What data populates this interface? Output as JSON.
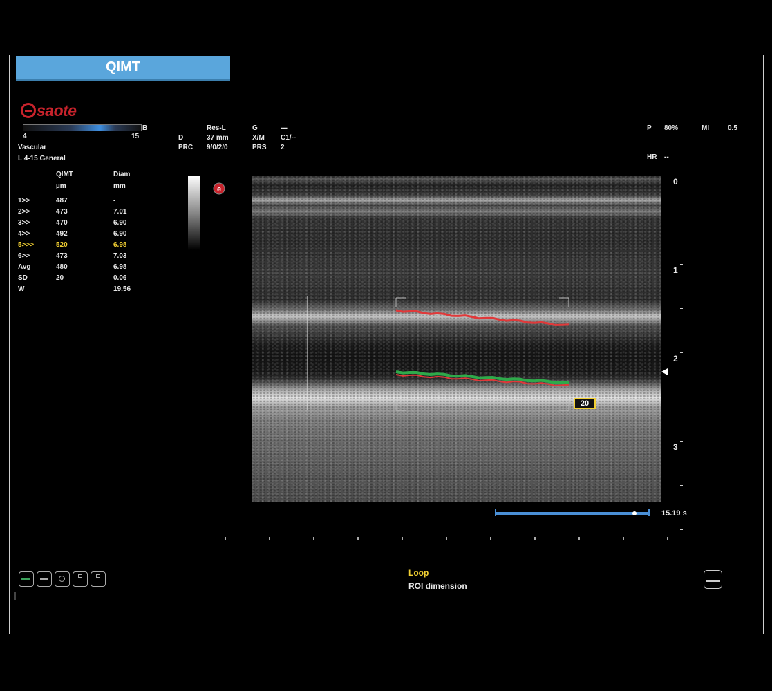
{
  "mode": {
    "title": "QIMT"
  },
  "brand": {
    "name": "saote"
  },
  "dynamic_range": {
    "left": "4",
    "right": "15",
    "unit": "B"
  },
  "preset": {
    "application": "Vascular",
    "probe": "L 4-15  General"
  },
  "params": [
    {
      "key": "Res-L",
      "value": ""
    },
    {
      "key": "D",
      "value": "37 mm"
    },
    {
      "key": "PRC",
      "value": "9/0/2/0"
    },
    {
      "key": "G",
      "value": "---"
    },
    {
      "key": "X/M",
      "value": "C1/--"
    },
    {
      "key": "PRS",
      "value": "2"
    }
  ],
  "power": {
    "label": "P",
    "value": "80%"
  },
  "mi": {
    "label": "MI",
    "value": "0.5"
  },
  "hr": {
    "label": "HR",
    "value": "--"
  },
  "measurements": {
    "headers": {
      "c1": "",
      "c2": "QIMT",
      "c3": "Diam"
    },
    "units": {
      "c1": "",
      "c2": "µm",
      "c3": "mm"
    },
    "rows": [
      {
        "label": "1>>",
        "qimt": "487",
        "diam": "-",
        "highlight": false
      },
      {
        "label": "2>>",
        "qimt": "473",
        "diam": "7.01",
        "highlight": false
      },
      {
        "label": "3>>",
        "qimt": "470",
        "diam": "6.90",
        "highlight": false
      },
      {
        "label": "4>>",
        "qimt": "492",
        "diam": "6.90",
        "highlight": false
      },
      {
        "label": "5>>>",
        "qimt": "520",
        "diam": "6.98",
        "highlight": true
      },
      {
        "label": "6>>",
        "qimt": "473",
        "diam": "7.03",
        "highlight": false
      },
      {
        "label": "Avg",
        "qimt": "480",
        "diam": "6.98",
        "highlight": false
      },
      {
        "label": "SD",
        "qimt": "20",
        "diam": "0.06",
        "highlight": false
      },
      {
        "label": "W",
        "qimt": "",
        "diam": "19.56",
        "highlight": false
      }
    ]
  },
  "depth_scale": [
    "0",
    "1",
    "2",
    "3"
  ],
  "roi_badge": "20",
  "loop": {
    "duration": "15.19 s",
    "position": 0.9
  },
  "status": {
    "line1": "Loop",
    "line2": "ROI dimension"
  },
  "colors": {
    "banner": "#5aa6dc",
    "brand": "#c8232c",
    "highlight": "#f2d033",
    "wall_red": "#e0393a",
    "wall_green": "#2eaa4a",
    "roi_box": "#f2d033"
  }
}
